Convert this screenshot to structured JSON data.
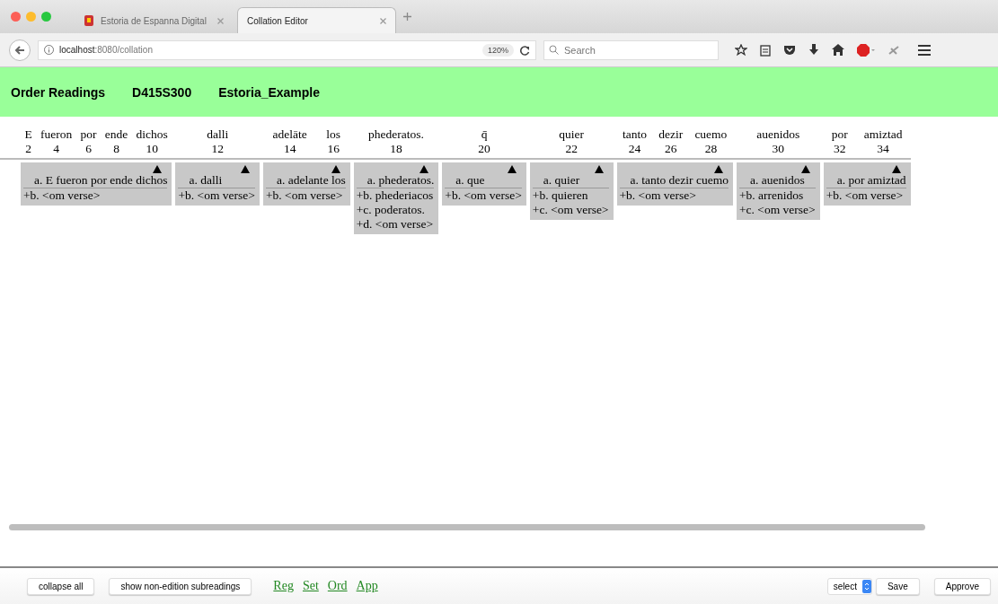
{
  "browser": {
    "tabs": [
      {
        "title": "Estoria de Espanna Digital",
        "selected": false
      },
      {
        "title": "Collation Editor",
        "selected": true
      }
    ],
    "url": "**localhost**:8080/collation",
    "zoom": "120%",
    "search": {
      "placeholder": "Search"
    }
  },
  "header": {
    "title": "Order Readings",
    "id": "D415S300",
    "project": "Estoria_Example"
  },
  "groups": [
    {
      "words": [
        {
          "text": "E",
          "index": "2"
        },
        {
          "text": "fueron",
          "index": "4"
        },
        {
          "text": "por",
          "index": "6"
        },
        {
          "text": "ende",
          "index": "8"
        },
        {
          "text": "dichos",
          "index": "10"
        }
      ],
      "readings": [
        {
          "kind": "main",
          "text": "a. E fueron por ende dichos"
        },
        {
          "kind": "sub",
          "text": "+b. <om verse>"
        }
      ]
    },
    {
      "words": [
        {
          "text": "dalli",
          "index": "12"
        }
      ],
      "readings": [
        {
          "kind": "main",
          "text": "a. dalli"
        },
        {
          "kind": "sub",
          "text": "+b. <om verse>"
        }
      ]
    },
    {
      "words": [
        {
          "text": "adelāte",
          "index": "14"
        },
        {
          "text": "los",
          "index": "16"
        }
      ],
      "readings": [
        {
          "kind": "main",
          "text": "a. adelante los"
        },
        {
          "kind": "sub",
          "text": "+b. <om verse>"
        }
      ]
    },
    {
      "words": [
        {
          "text": "phederatos.",
          "index": "18"
        }
      ],
      "readings": [
        {
          "kind": "main",
          "text": "a. phederatos."
        },
        {
          "kind": "sub",
          "text": "+b. phederiacos"
        },
        {
          "kind": "sub",
          "text": "+c. poderatos."
        },
        {
          "kind": "sub",
          "text": "+d. <om verse>"
        }
      ]
    },
    {
      "words": [
        {
          "text": "q̄",
          "index": "20"
        }
      ],
      "readings": [
        {
          "kind": "main",
          "text": "a. que"
        },
        {
          "kind": "sub",
          "text": "+b. <om verse>"
        }
      ]
    },
    {
      "words": [
        {
          "text": "quier",
          "index": "22"
        }
      ],
      "readings": [
        {
          "kind": "main",
          "text": "a. quier"
        },
        {
          "kind": "sub",
          "text": "+b. quieren"
        },
        {
          "kind": "sub",
          "text": "+c. <om verse>"
        }
      ]
    },
    {
      "words": [
        {
          "text": "tanto",
          "index": "24"
        },
        {
          "text": "dezir",
          "index": "26"
        },
        {
          "text": "cuemo",
          "index": "28"
        }
      ],
      "readings": [
        {
          "kind": "main",
          "text": "a. tanto dezir cuemo"
        },
        {
          "kind": "sub",
          "text": "+b. <om verse>"
        }
      ]
    },
    {
      "words": [
        {
          "text": "auenidos",
          "index": "30"
        }
      ],
      "readings": [
        {
          "kind": "main",
          "text": "a. auenidos"
        },
        {
          "kind": "sub",
          "text": "+b. arrenidos"
        },
        {
          "kind": "sub",
          "text": "+c. <om verse>"
        }
      ]
    },
    {
      "words": [
        {
          "text": "por",
          "index": "32"
        },
        {
          "text": "amiztad",
          "index": "34"
        }
      ],
      "readings": [
        {
          "kind": "main",
          "text": "a. por amiztad"
        },
        {
          "kind": "sub",
          "text": "+b. <om verse>"
        }
      ]
    }
  ],
  "footer": {
    "buttons": [
      "collapse all",
      "show non-edition subreadings"
    ],
    "links": [
      "Reg",
      "Set",
      "Ord",
      "App"
    ],
    "select": "select",
    "save": "Save",
    "approve": "Approve"
  }
}
